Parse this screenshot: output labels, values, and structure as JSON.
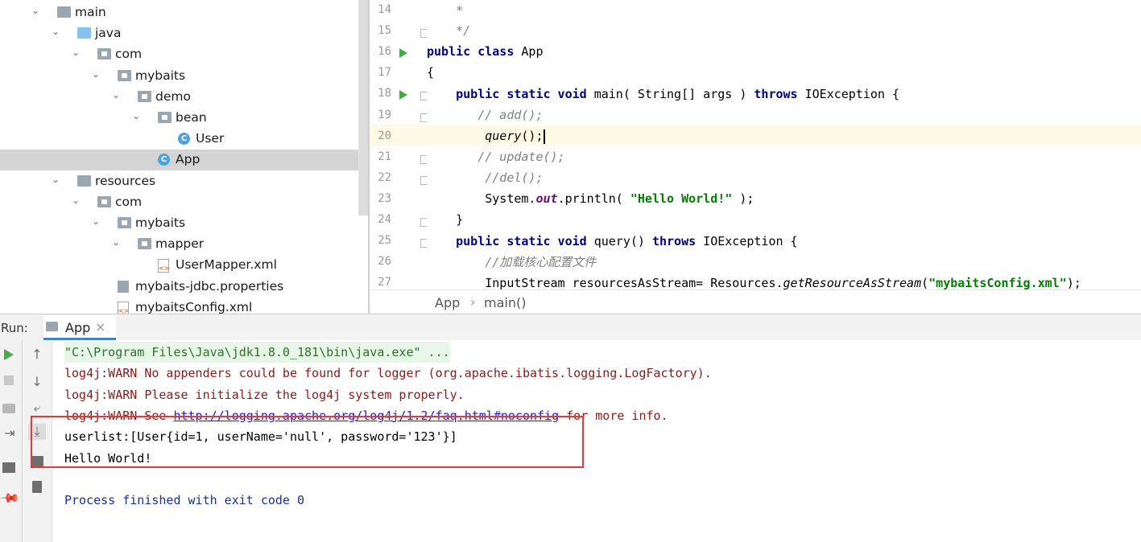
{
  "project_tree": {
    "items": [
      {
        "label": "main",
        "depth": 0,
        "icon": "folder-icon",
        "expanded": true
      },
      {
        "label": "java",
        "depth": 1,
        "icon": "source-folder-icon",
        "expanded": true
      },
      {
        "label": "com",
        "depth": 2,
        "icon": "package-icon",
        "expanded": true
      },
      {
        "label": "mybaits",
        "depth": 3,
        "icon": "package-icon",
        "expanded": true
      },
      {
        "label": "demo",
        "depth": 4,
        "icon": "package-icon",
        "expanded": true
      },
      {
        "label": "bean",
        "depth": 5,
        "icon": "package-icon",
        "expanded": true
      },
      {
        "label": "User",
        "depth": 6,
        "icon": "java-class-icon"
      },
      {
        "label": "App",
        "depth": 5,
        "icon": "java-class-icon",
        "selected": true
      },
      {
        "label": "resources",
        "depth": 1,
        "icon": "resources-folder-icon",
        "expanded": true
      },
      {
        "label": "com",
        "depth": 2,
        "icon": "package-icon",
        "expanded": true
      },
      {
        "label": "mybaits",
        "depth": 3,
        "icon": "package-icon",
        "expanded": true
      },
      {
        "label": "mapper",
        "depth": 4,
        "icon": "package-icon",
        "expanded": true
      },
      {
        "label": "UserMapper.xml",
        "depth": 5,
        "icon": "xml-file-icon"
      },
      {
        "label": "mybaits-jdbc.properties",
        "depth": 3,
        "icon": "properties-file-icon"
      },
      {
        "label": "mybaitsConfig.xml",
        "depth": 3,
        "icon": "xml-file-icon"
      }
    ]
  },
  "editor": {
    "line_numbers": [
      "14",
      "15",
      "16",
      "17",
      "18",
      "19",
      "20",
      "21",
      "22",
      "23",
      "24",
      "25",
      "26",
      "27"
    ],
    "current_line": "20",
    "breadcrumb": [
      "App",
      "main()"
    ],
    "breadcrumb_sep": "›"
  },
  "run": {
    "label": "Run:",
    "tab": "App",
    "tab_close": "×",
    "console": [
      {
        "text": "\"C:\\Program Files\\Java\\jdk1.8.0_181\\bin\\java.exe\" ...",
        "kind": "cmd"
      },
      {
        "text": "log4j:WARN No appenders could be found for logger (org.apache.ibatis.logging.LogFactory).",
        "kind": "err"
      },
      {
        "text": "log4j:WARN Please initialize the log4j system properly.",
        "kind": "err"
      },
      {
        "pre": "log4j:WARN See ",
        "link": "http://logging.apache.org/log4j/1.2/faq.html#noconfig",
        "post": " for more info.",
        "kind": "err"
      },
      {
        "text": "userlist:[User{id=1, userName='null', password='123'}]",
        "kind": "out"
      },
      {
        "text": "Hello World!",
        "kind": "out"
      },
      {
        "text": "",
        "kind": "out"
      },
      {
        "text": "Process finished with exit code 0",
        "kind": "fin"
      }
    ]
  },
  "colors": {
    "keyword": "#000080",
    "comment": "#808080",
    "string": "#008000",
    "highlight_box": "#e53935",
    "run_icon": "#49a84a"
  }
}
